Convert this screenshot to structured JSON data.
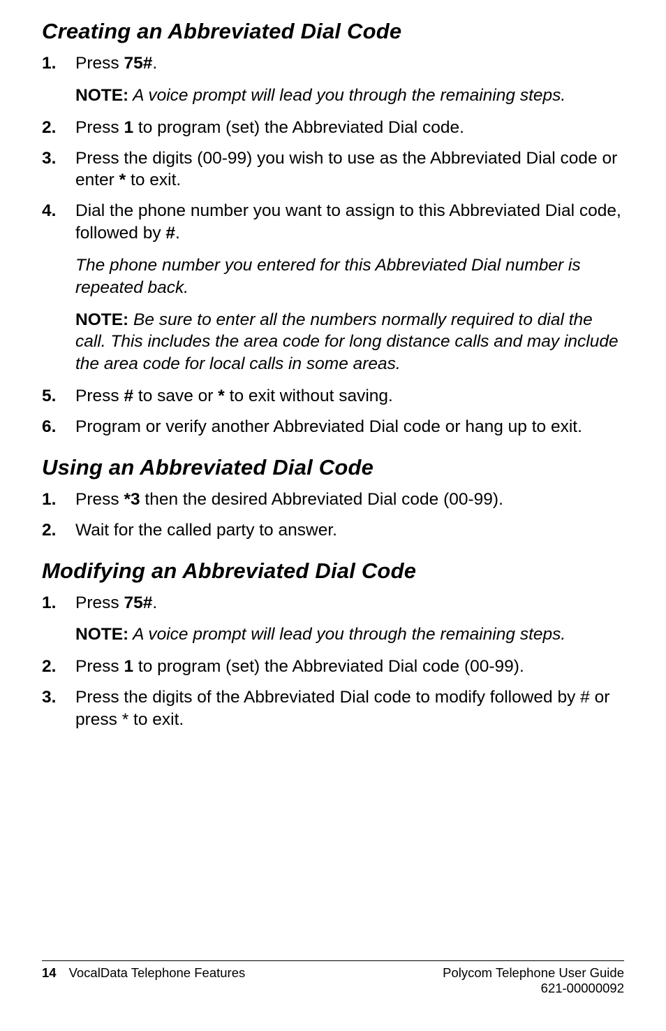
{
  "sections": {
    "creating": {
      "heading": "Creating an Abbreviated Dial Code",
      "items": {
        "i1": {
          "marker": "1.",
          "prefix": "Press ",
          "code": "75#",
          "suffix": ".",
          "note_label": "NOTE:",
          "note_text": " A voice prompt will lead you through the remaining steps."
        },
        "i2": {
          "marker": "2.",
          "prefix": "Press ",
          "code": "1",
          "suffix": " to program (set) the Abbreviated Dial code."
        },
        "i3": {
          "marker": "3.",
          "prefix": "Press the digits (00-99) you wish to use as the Abbreviated Dial code or enter ",
          "code": "*",
          "suffix": " to exit."
        },
        "i4": {
          "marker": "4.",
          "prefix": "Dial the phone number you want to assign to this Abbreviated Dial code, followed by ",
          "code": "#",
          "suffix": ".",
          "sub_italic": "The phone number you entered for this Abbreviated Dial number is repeated back.",
          "note_label": "NOTE:",
          "note_text": " Be sure to enter all the numbers normally required to dial the call. This includes the area code for long distance calls and may include the area code for local calls in some areas."
        },
        "i5": {
          "marker": "5.",
          "prefix": "Press ",
          "code1": "#",
          "mid": " to save or ",
          "code2": "*",
          "suffix": " to exit without saving."
        },
        "i6": {
          "marker": "6.",
          "text": "Program or verify another Abbreviated Dial code or hang up to exit."
        }
      }
    },
    "using": {
      "heading": "Using an Abbreviated Dial Code",
      "items": {
        "i1": {
          "marker": "1.",
          "prefix": "Press ",
          "code": "*3",
          "suffix": " then the desired Abbreviated Dial code (00-99)."
        },
        "i2": {
          "marker": "2.",
          "text": "Wait for the called party to answer."
        }
      }
    },
    "modifying": {
      "heading": "Modifying an Abbreviated Dial Code",
      "items": {
        "i1": {
          "marker": "1.",
          "prefix": "Press ",
          "code": "75#",
          "suffix": ".",
          "note_label": "NOTE:",
          "note_text": " A voice prompt will lead you through the remaining steps."
        },
        "i2": {
          "marker": "2.",
          "prefix": "Press ",
          "code": "1",
          "suffix": " to program (set) the Abbreviated Dial code (00-99)."
        },
        "i3": {
          "marker": "3.",
          "text": "Press the digits of the Abbreviated Dial code to modify followed by # or press * to exit."
        }
      }
    }
  },
  "footer": {
    "page_number": "14",
    "left_text": "VocalData Telephone Features",
    "right_line1": "Polycom Telephone User Guide",
    "right_line2": "621-00000092"
  }
}
